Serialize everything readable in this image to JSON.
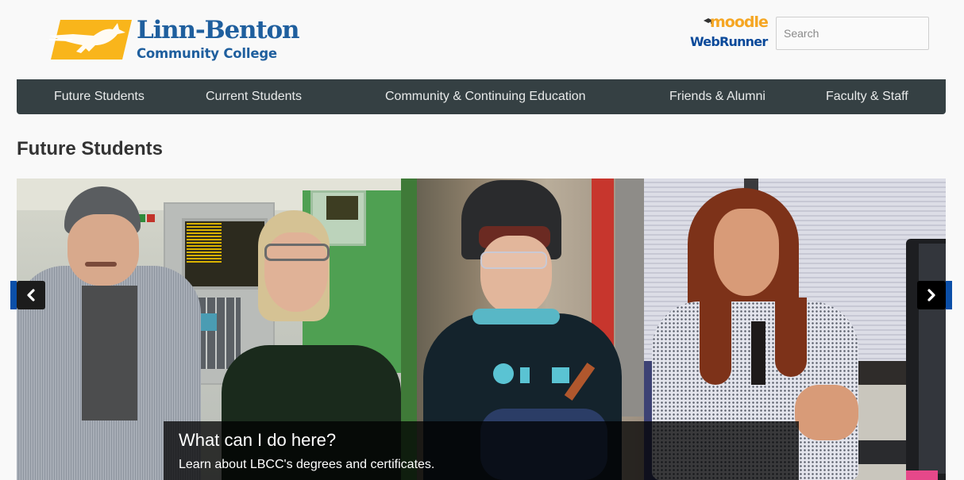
{
  "header": {
    "logo": {
      "name": "Linn-Benton",
      "subtitle": "Community College",
      "brand_blue": "#1f5f9e",
      "brand_yellow": "#f9b51b"
    },
    "moodle": {
      "label": "moodle",
      "color": "#f5a623"
    },
    "webrunner": {
      "label": "WebRunner",
      "color": "#0b4a9a"
    },
    "search": {
      "placeholder": "Search",
      "value": ""
    }
  },
  "nav": {
    "background": "#354043",
    "items": [
      {
        "label": "Future Students"
      },
      {
        "label": "Current Students"
      },
      {
        "label": "Community & Continuing Education"
      },
      {
        "label": "Friends & Alumni"
      },
      {
        "label": "Faculty & Staff"
      }
    ]
  },
  "page": {
    "title": "Future Students"
  },
  "carousel": {
    "caption": {
      "title": "What can I do here?",
      "text": "Learn about LBCC's degrees and certificates."
    },
    "prev_icon": "chevron-left-icon",
    "next_icon": "chevron-right-icon",
    "accent_color": "#0b4fa8",
    "photos": [
      {
        "description": "Two students standing in front of a HAAS CNC machine"
      },
      {
        "description": "Welding student wearing a raised welding helmet and safety glasses"
      },
      {
        "description": "Student seated at a desk with a computer monitor"
      }
    ]
  }
}
